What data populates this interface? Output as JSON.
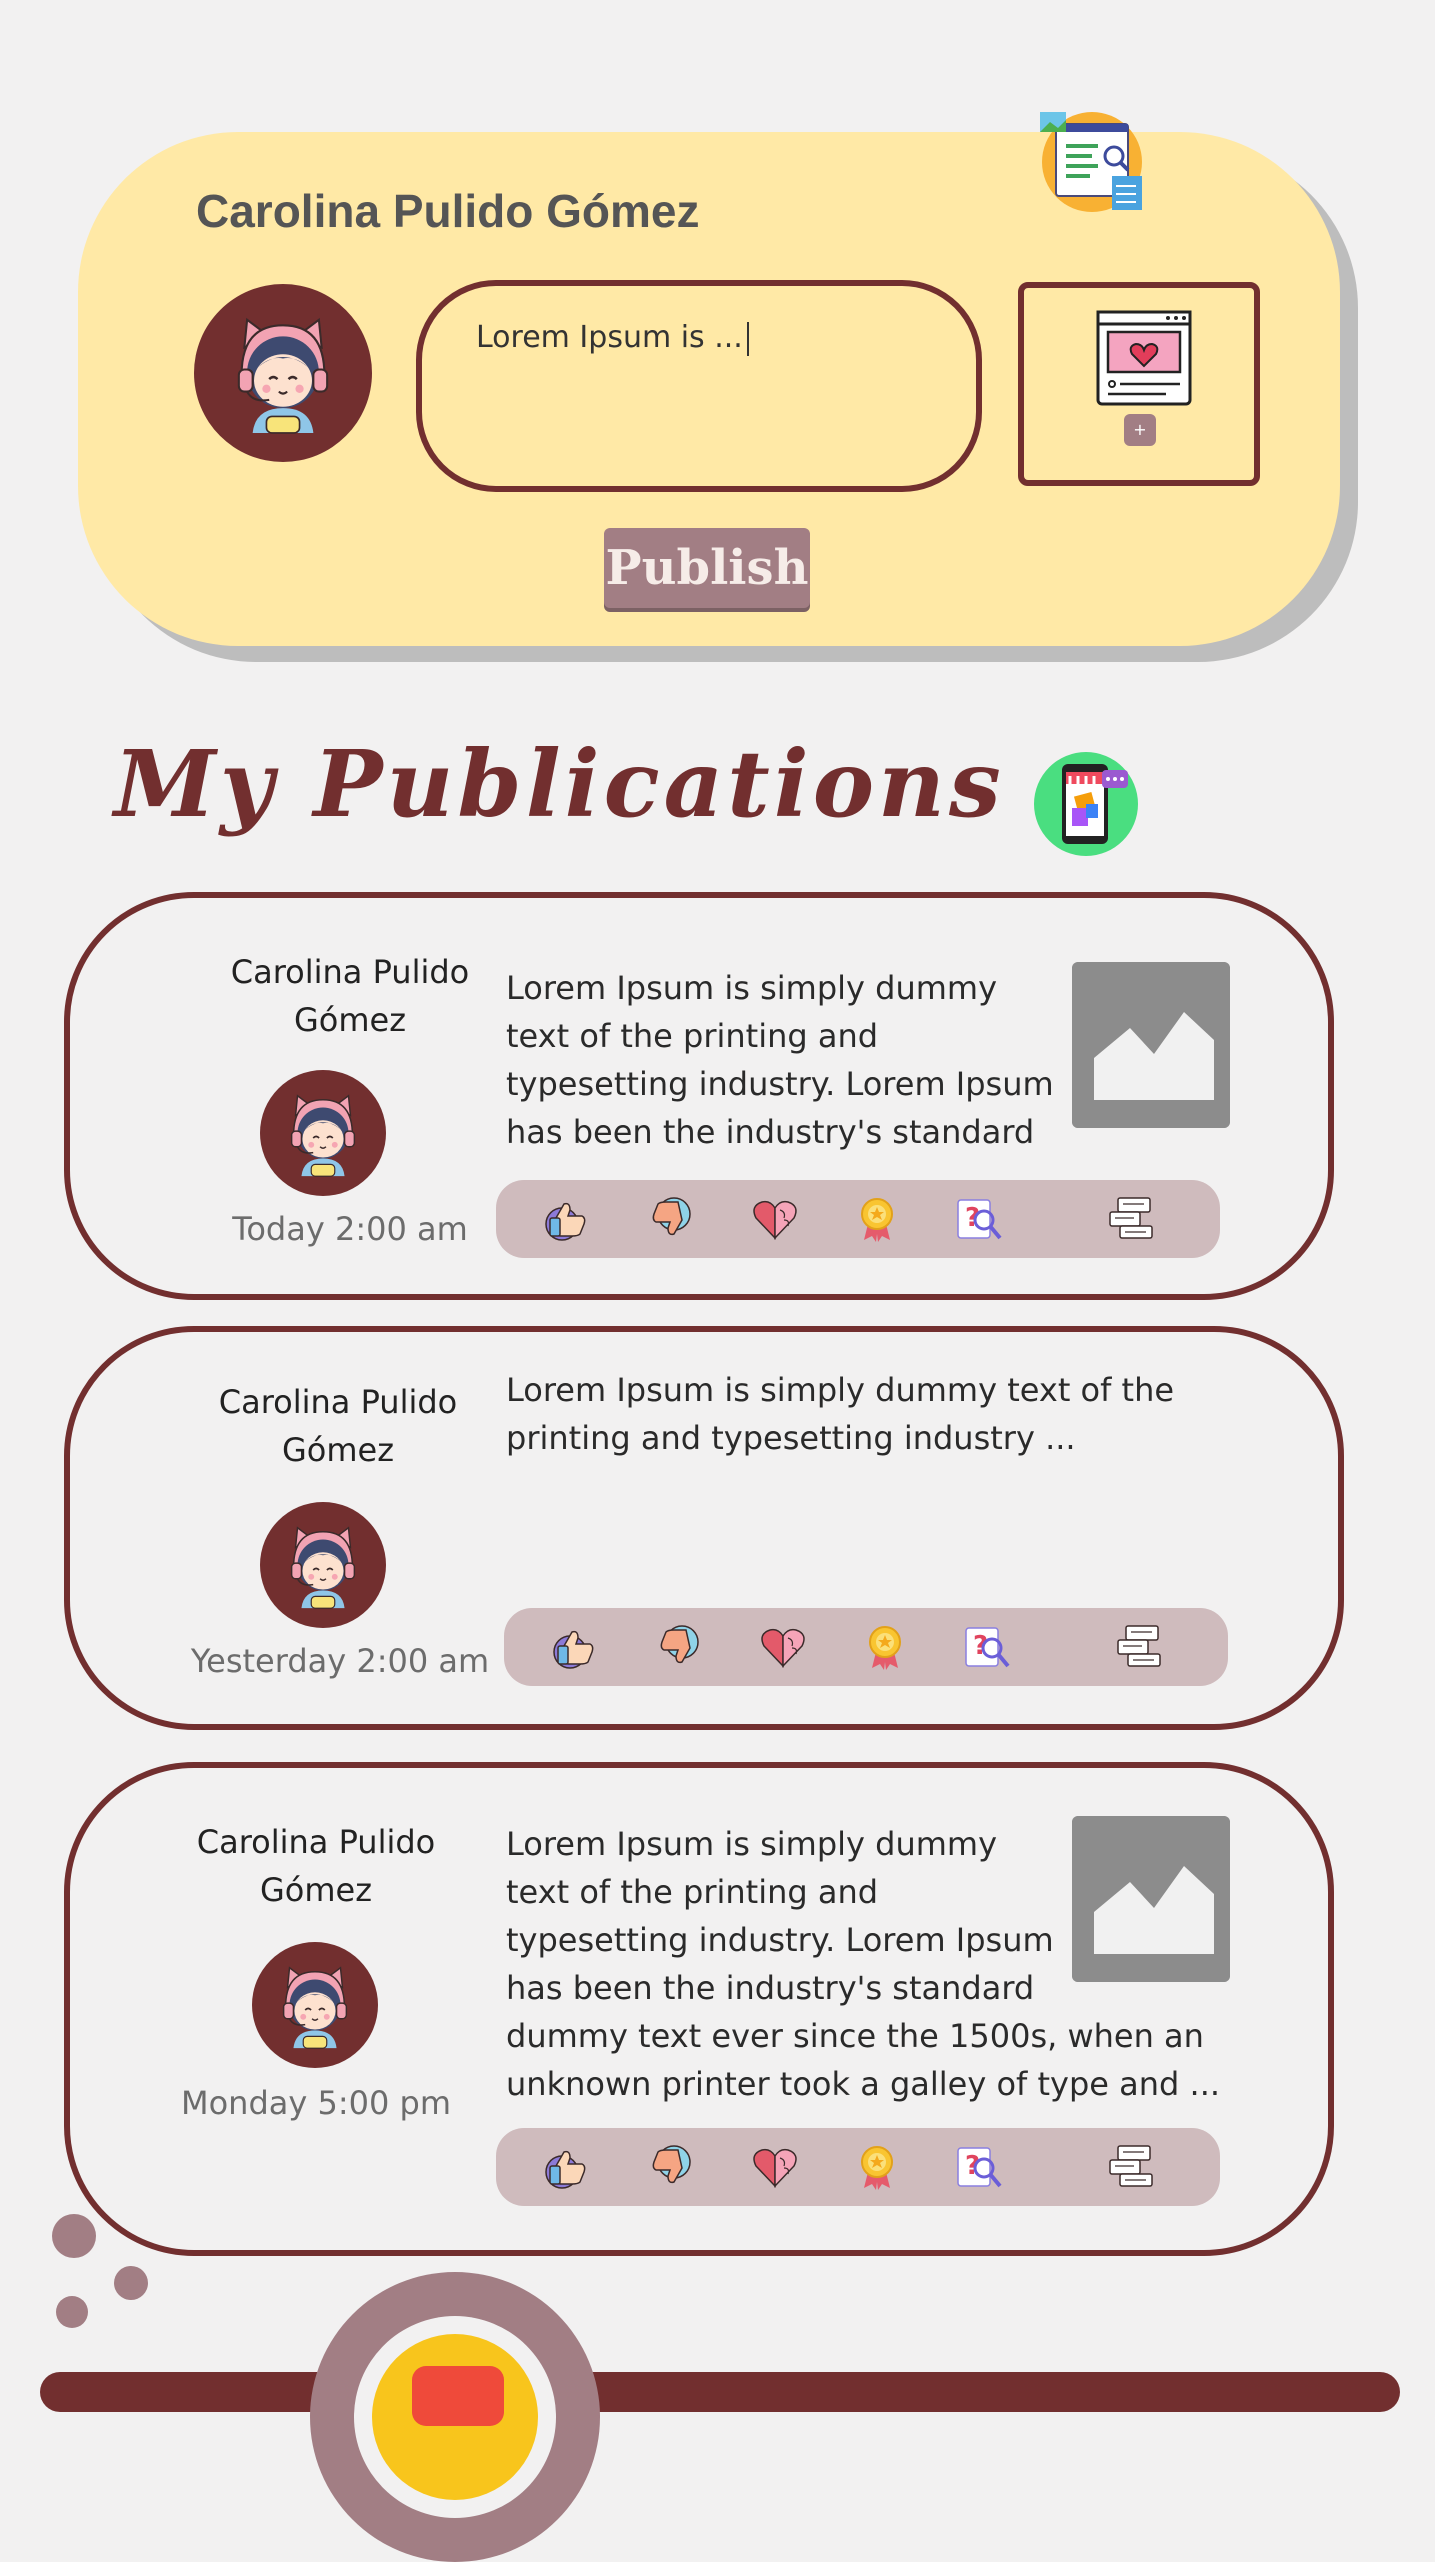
{
  "composer": {
    "author_name": "Carolina Pulido Gómez",
    "input_value": "Lorem Ipsum is  ...",
    "add_media_label": "+",
    "publish_label": "Publish"
  },
  "section": {
    "title": "My Publications"
  },
  "posts": [
    {
      "author_line1": "Carolina Pulido",
      "author_line2": "Gómez",
      "time": "Today 2:00 am",
      "text_lines": [
        "Lorem Ipsum is simply dummy",
        "text of the printing and",
        "typesetting industry. Lorem Ipsum",
        "has been the industry's standard"
      ],
      "has_image": true
    },
    {
      "author_line1": "Carolina Pulido",
      "author_line2": "Gómez",
      "time": "Yesterday 2:00 am",
      "text_lines": [
        "Lorem Ipsum is simply dummy text of the",
        "printing and typesetting industry  ..."
      ],
      "has_image": false
    },
    {
      "author_line1": "Carolina Pulido",
      "author_line2": "Gómez",
      "time": "Monday 5:00 pm",
      "text_lines": [
        "Lorem Ipsum is simply dummy",
        "text of the printing and",
        "typesetting industry. Lorem Ipsum",
        "has been the industry's standard",
        "dummy text ever since the 1500s, when an",
        "unknown printer took a galley of type and ..."
      ],
      "has_image": true
    }
  ],
  "reactions": [
    "thumbs-up-icon",
    "thumbs-down-icon",
    "heart-brain-icon",
    "medal-icon",
    "question-search-icon",
    "comments-icon"
  ],
  "colors": {
    "accent": "#722f2f",
    "composer_bg": "#ffe9a6",
    "button": "#a27e84",
    "reaction_bar": "#cfbbbd",
    "page_bg": "#f2f1f1"
  }
}
